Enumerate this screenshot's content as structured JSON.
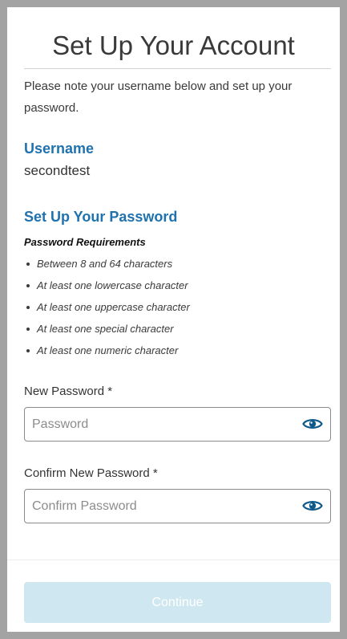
{
  "title": "Set Up Your Account",
  "intro": "Please note your username below and set up your password.",
  "username": {
    "heading": "Username",
    "value": "secondtest"
  },
  "password_setup": {
    "heading": "Set Up Your Password",
    "requirements_title": "Password Requirements",
    "requirements": [
      "Between 8 and 64 characters",
      "At least one lowercase character",
      "At least one uppercase character",
      "At least one special character",
      "At least one numeric character"
    ]
  },
  "fields": {
    "new_password": {
      "label": "New Password *",
      "placeholder": "Password",
      "value": "",
      "toggle_icon": "eye-icon"
    },
    "confirm_password": {
      "label": "Confirm New Password *",
      "placeholder": "Confirm Password",
      "value": "",
      "toggle_icon": "eye-icon"
    }
  },
  "continue_button": {
    "label": "Continue",
    "state": "disabled"
  },
  "colors": {
    "accent": "#1f72ae",
    "icon": "#0f5a8a",
    "button_disabled_bg": "#cfe7f0"
  }
}
